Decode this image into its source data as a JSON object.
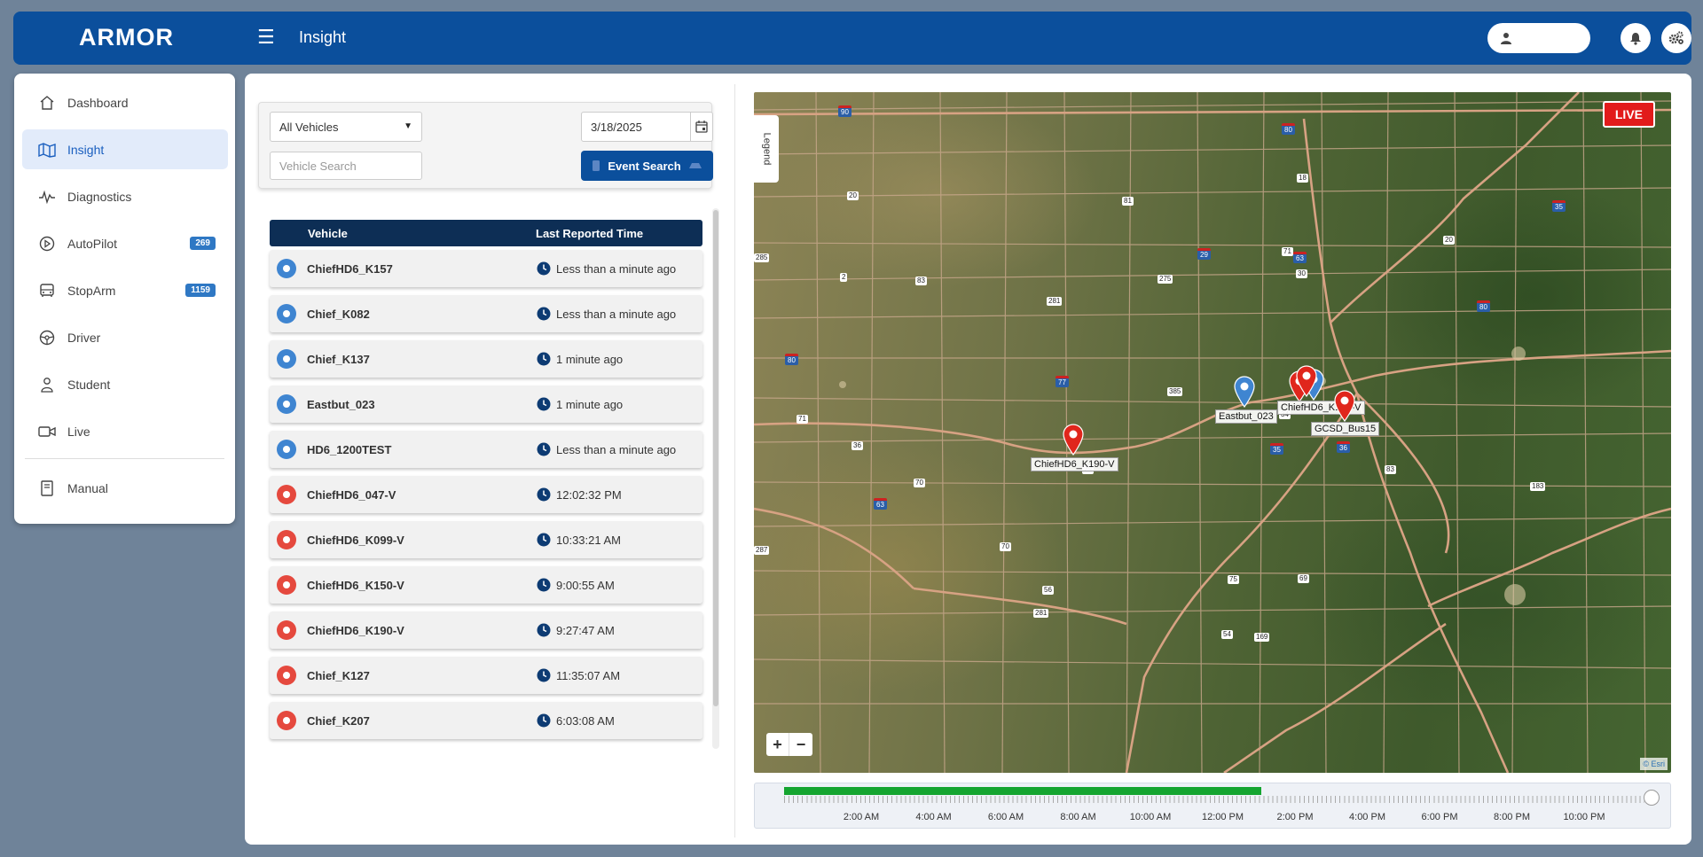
{
  "app": {
    "logo": "ARMOR",
    "page_title": "Insight"
  },
  "sidebar": {
    "items": [
      {
        "label": "Dashboard",
        "icon": "home-icon",
        "active": false
      },
      {
        "label": "Insight",
        "icon": "map-icon",
        "active": true
      },
      {
        "label": "Diagnostics",
        "icon": "pulse-icon",
        "active": false
      },
      {
        "label": "AutoPilot",
        "icon": "play-circle-icon",
        "active": false,
        "badge": "269"
      },
      {
        "label": "StopArm",
        "icon": "bus-icon",
        "active": false,
        "badge": "1159"
      },
      {
        "label": "Driver",
        "icon": "steering-wheel-icon",
        "active": false
      },
      {
        "label": "Student",
        "icon": "student-icon",
        "active": false
      },
      {
        "label": "Live",
        "icon": "video-camera-icon",
        "active": false
      }
    ],
    "footer_item": {
      "label": "Manual",
      "icon": "book-icon"
    }
  },
  "filters": {
    "vehicle_select": "All Vehicles",
    "vehicle_search_placeholder": "Vehicle Search",
    "date": "3/18/2025",
    "event_search_label": "Event Search"
  },
  "vehicle_list": {
    "headers": {
      "vehicle": "Vehicle",
      "last_reported": "Last Reported Time"
    },
    "rows": [
      {
        "name": "ChiefHD6_K157",
        "time": "Less than a minute ago",
        "status": "blue"
      },
      {
        "name": "Chief_K082",
        "time": "Less than a minute ago",
        "status": "blue"
      },
      {
        "name": "Chief_K137",
        "time": "1 minute ago",
        "status": "blue"
      },
      {
        "name": "Eastbut_023",
        "time": "1 minute ago",
        "status": "blue"
      },
      {
        "name": "HD6_1200TEST",
        "time": "Less than a minute ago",
        "status": "blue"
      },
      {
        "name": "ChiefHD6_047-V",
        "time": "12:02:32 PM",
        "status": "red"
      },
      {
        "name": "ChiefHD6_K099-V",
        "time": "10:33:21 AM",
        "status": "red"
      },
      {
        "name": "ChiefHD6_K150-V",
        "time": "9:00:55 AM",
        "status": "red"
      },
      {
        "name": "ChiefHD6_K190-V",
        "time": "9:27:47 AM",
        "status": "red"
      },
      {
        "name": "Chief_K127",
        "time": "11:35:07 AM",
        "status": "red"
      },
      {
        "name": "Chief_K207",
        "time": "6:03:08 AM",
        "status": "red"
      }
    ]
  },
  "map": {
    "legend_label": "Legend",
    "live_badge": "LIVE",
    "zoom_in": "+",
    "zoom_out": "−",
    "attribution": "© Esri",
    "marker_labels": {
      "eastbut": "Eastbut_023",
      "chief_cluster": "ChiefHD6_K1?9-V",
      "gcsd": "GCSD_Bus15",
      "k190": "ChiefHD6_K190-V"
    },
    "route_shields": [
      "90",
      "80",
      "18",
      "35",
      "20",
      "81",
      "29",
      "71",
      "63",
      "20",
      "285",
      "2",
      "83",
      "275",
      "30",
      "281",
      "80",
      "80",
      "77",
      "385",
      "71",
      "34",
      "36",
      "29",
      "35",
      "36",
      "83",
      "70",
      "63",
      "183",
      "70",
      "287",
      "75",
      "69",
      "56",
      "281",
      "54",
      "169"
    ]
  },
  "timeline": {
    "labels": [
      "2:00 AM",
      "4:00 AM",
      "6:00 AM",
      "8:00 AM",
      "10:00 AM",
      "12:00 PM",
      "2:00 PM",
      "4:00 PM",
      "6:00 PM",
      "8:00 PM",
      "10:00 PM"
    ],
    "progress_fraction": 0.555,
    "fill_color": "#15a530"
  },
  "colors": {
    "brand": "#0b4f9c",
    "header_dark": "#0d2e55",
    "status_blue": "#3f85d1",
    "status_red": "#e5493e",
    "live_red": "#e21b1b"
  }
}
